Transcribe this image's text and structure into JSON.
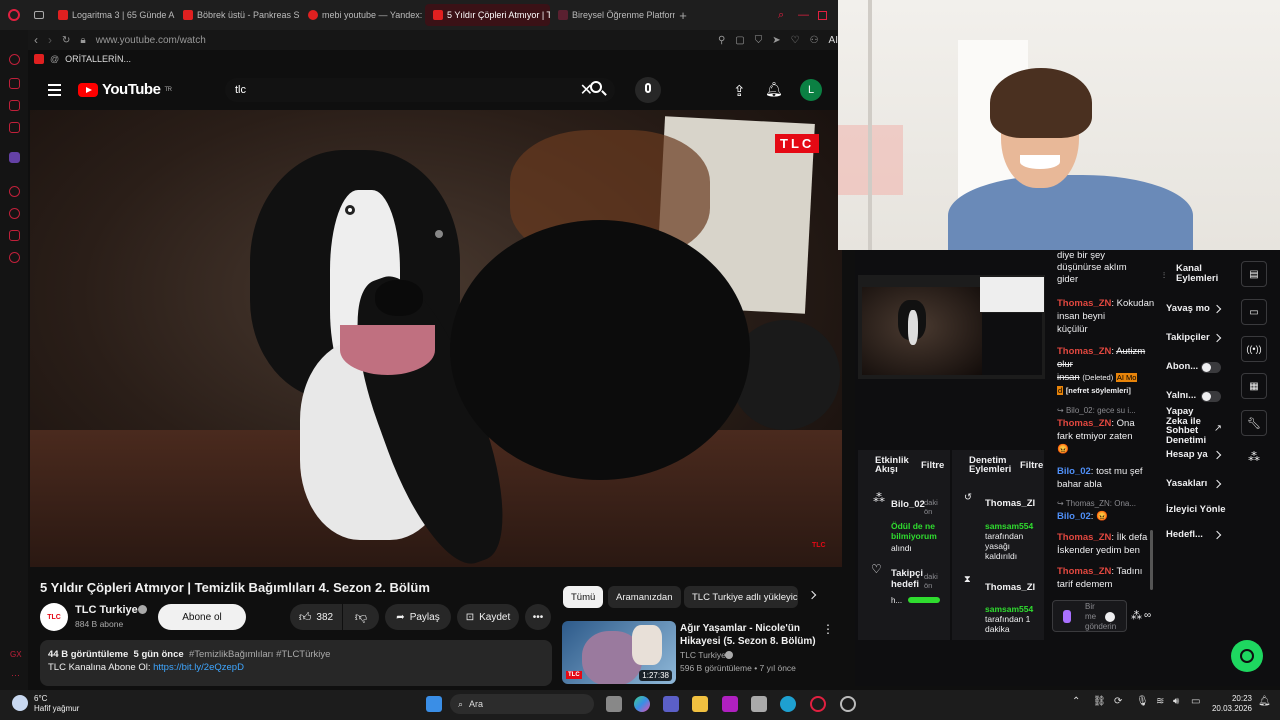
{
  "browser": {
    "tabs": [
      {
        "label": "Logaritma 3 | 65 Günde A"
      },
      {
        "label": "Böbrek üstü - Pankreas S"
      },
      {
        "label": "mebi youtube — Yandex: "
      },
      {
        "label": "5 Yıldır Çöpleri Atmıyor | T"
      },
      {
        "label": "Bireysel Öğrenme Platform"
      }
    ],
    "url": "www.youtube.com/watch",
    "bookmark": "ORİTALLERİN...",
    "ai_label": "AI"
  },
  "youtube": {
    "logo_text": "YouTube",
    "logo_region": "TR",
    "search_value": "tlc",
    "avatar_letter": "L",
    "video_watermark": "TLC",
    "video_corner_mark": "TLC",
    "title": "5 Yıldır Çöpleri Atmıyor | Temizlik Bağımlıları 4. Sezon 2. Bölüm",
    "channel_name": "TLC Turkiye",
    "channel_logo": "TLC",
    "subscribers": "884 B abone",
    "subscribe_label": "Abone ol",
    "likes": "382",
    "share_label": "Paylaş",
    "save_label": "Kaydet",
    "views": "44 B görüntüleme",
    "age": "5 gün önce",
    "hashtags": "#TemizlikBağımlıları #TLCTürkiye",
    "desc_prefix": "TLC Kanalına Abone Ol:",
    "desc_link": "https://bit.ly/2eQzepD",
    "chips": [
      "Tümü",
      "Aramanızdan",
      "TLC Turkiye adlı yükleyic"
    ],
    "rec": {
      "title_line1": "Ağır Yaşamlar - Nicole'ün",
      "title_line2": "Hikayesi (5. Sezon 8. Bölüm)",
      "channel": "TLC Turkiye",
      "meta": "596 B görüntüleme  •  7 yıl önce",
      "duration": "1:27:38",
      "thumb_logo": "TLC"
    }
  },
  "panel": {
    "activity": {
      "title_line1": "Etkinlik",
      "title_line2": "Akışı",
      "filter": "Filtre",
      "items": [
        {
          "user": "Bilo_02",
          "time1": "daki",
          "time2": "ön",
          "text_line1": "Ödül de ne",
          "text_line2": "bilmiyorum",
          "text_line3": "alındı"
        },
        {
          "user_line1": "Takipçi",
          "user_line2": "hedefi",
          "time1": "daki",
          "time2": "ön",
          "progress_label": "h..."
        }
      ]
    },
    "moderation": {
      "title_line1": "Denetim",
      "title_line2": "Eylemleri",
      "filter": "Filtre",
      "items": [
        {
          "user": "Thomas_ZI",
          "mod": "samsam554",
          "line2": "tarafından",
          "line3": "yasağı",
          "line4": "kaldırıldı"
        },
        {
          "user": "Thomas_ZI",
          "mod": "samsam554",
          "line2": "tarafından 1",
          "line3": "dakika"
        }
      ]
    },
    "chat": {
      "top_line1": "diye bir şey",
      "top_line2": "düşünürse aklım",
      "top_line3": "gider",
      "m1_user": "Thomas_ZN",
      "m1_l1": "Kokudan insan beyni",
      "m1_l2": "küçülür",
      "m2_user": "Thomas_ZN",
      "m2_l1": "Autizm",
      "m2_l2": "olur",
      "m2_l3": "insan",
      "m2_deleted": "(Deleted)",
      "m2_badge": "AI Mo",
      "m2_badge2": "d",
      "m2_tag": "[nefret söylemleri]",
      "reply1": "Bilo_02: gece su i...",
      "m3_user": "Thomas_ZN",
      "m3_l1": "Ona",
      "m3_l2": "fark etmiyor zaten",
      "m4_user": "Bilo_02",
      "m4_l1": "tost mu şef",
      "m4_l2": "bahar abla",
      "reply2": "Thomas_ZN: Ona...",
      "m5_user": "Bilo_02",
      "m6_user": "Thomas_ZN",
      "m6_l1": "İlk defa",
      "m6_l2": "İskender yedim ben",
      "m7_user": "Thomas_ZN",
      "m7_l1": "Tadını",
      "m7_l2": "tarif edemem",
      "input_line1": "Bir",
      "input_line2": "me",
      "input_line3": "gönderin"
    },
    "actions": {
      "title_line1": "Kanal",
      "title_line2": "Eylemleri",
      "items": [
        "Yavaş mo",
        "Takipçiler",
        "Abon...",
        "Yalnı...",
        "Yapay",
        "Zeka ile",
        "Sohbet",
        "Denetimi",
        "Hesap ya",
        "Yasakları",
        "İzleyici Yönle",
        "Hedefl..."
      ]
    }
  },
  "taskbar": {
    "weather_temp": "6°C",
    "weather_desc": "Hafif yağmur",
    "search_label": "Ara",
    "time": "20:23",
    "date": "20.03.2026"
  }
}
